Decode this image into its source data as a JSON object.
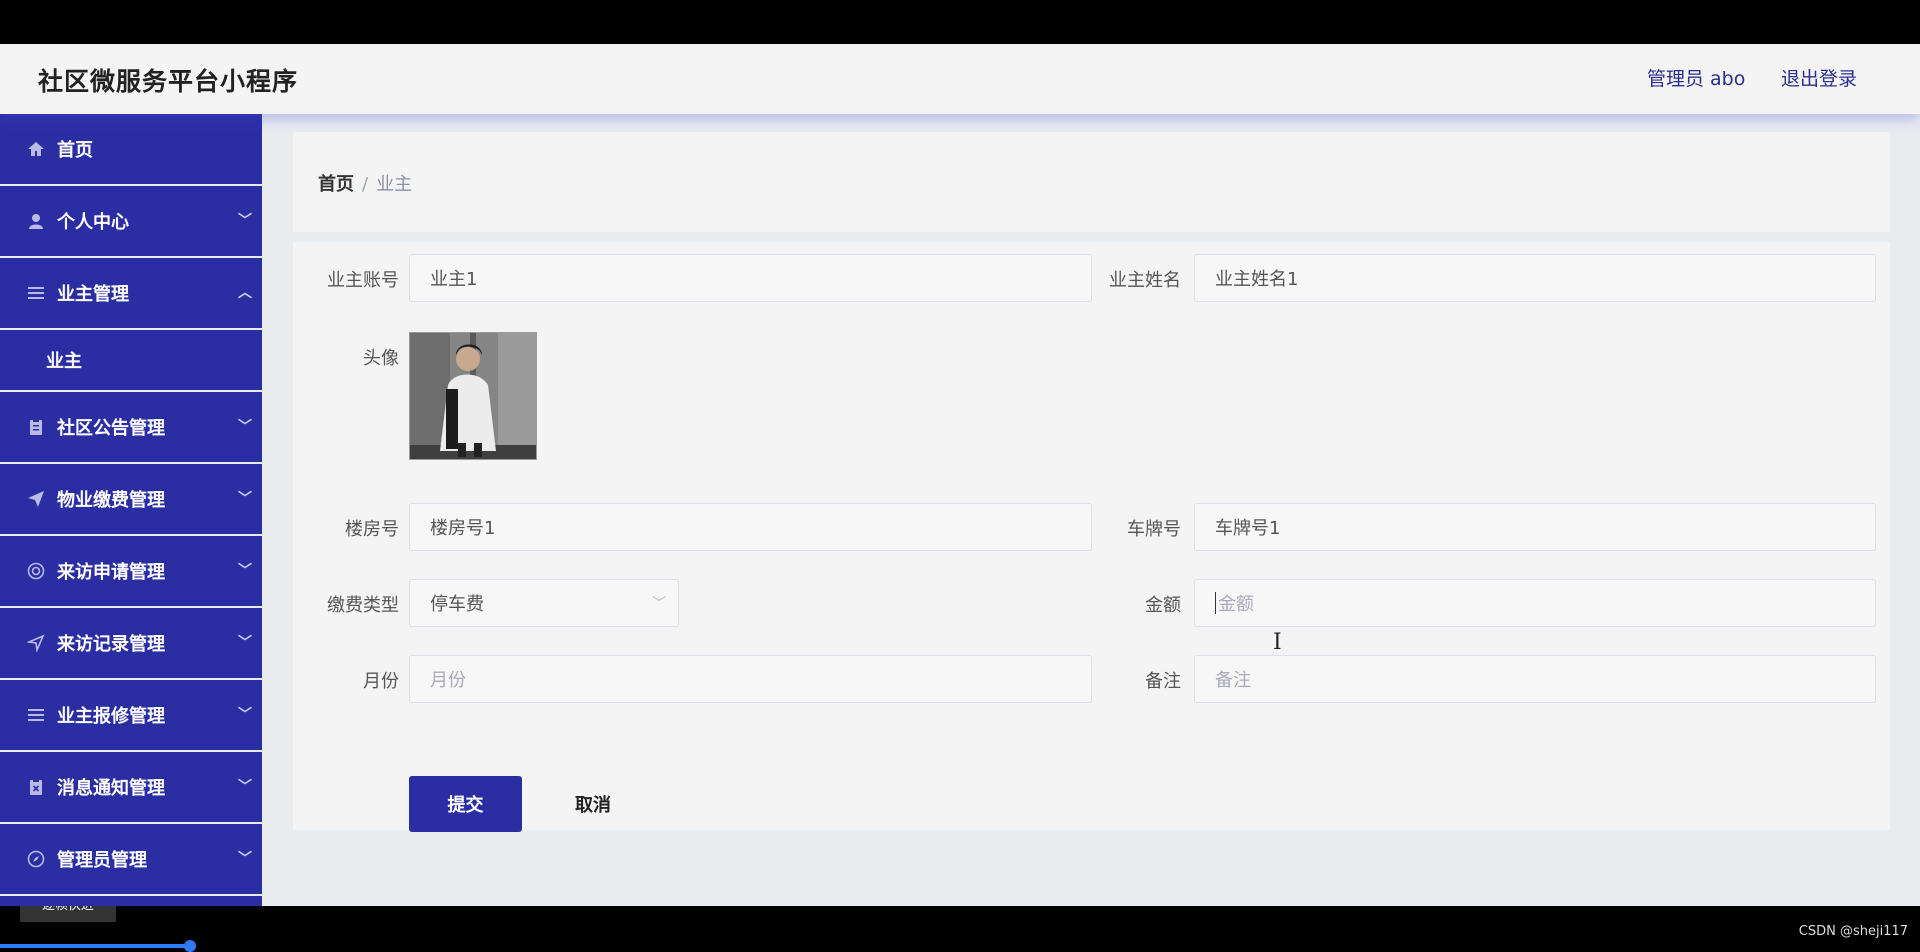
{
  "header": {
    "title": "社区微服务平台小程序",
    "user": "管理员 abo",
    "logout": "退出登录"
  },
  "sidebar": {
    "items": [
      {
        "label": "首页",
        "icon": "home-icon"
      },
      {
        "label": "个人中心",
        "icon": "user-icon"
      },
      {
        "label": "业主管理",
        "icon": "list-icon",
        "expanded": true
      },
      {
        "label": "业主",
        "sub": true
      },
      {
        "label": "社区公告管理",
        "icon": "clipboard-icon"
      },
      {
        "label": "物业缴费管理",
        "icon": "send-icon"
      },
      {
        "label": "来访申请管理",
        "icon": "lifebuoy-icon"
      },
      {
        "label": "来访记录管理",
        "icon": "navigation-icon"
      },
      {
        "label": "业主报修管理",
        "icon": "list-icon"
      },
      {
        "label": "消息通知管理",
        "icon": "clipboard-x-icon"
      },
      {
        "label": "管理员管理",
        "icon": "compass-icon"
      }
    ]
  },
  "breadcrumb": {
    "home": "首页",
    "separator": "/",
    "current": "业主"
  },
  "form": {
    "account_label": "业主账号",
    "account_value": "业主1",
    "name_label": "业主姓名",
    "name_value": "业主姓名1",
    "avatar_label": "头像",
    "building_label": "楼房号",
    "building_value": "楼房号1",
    "plate_label": "车牌号",
    "plate_value": "车牌号1",
    "fee_type_label": "缴费类型",
    "fee_type_value": "停车费",
    "amount_label": "金额",
    "amount_placeholder": "金额",
    "month_label": "月份",
    "month_placeholder": "月份",
    "remark_label": "备注",
    "remark_placeholder": "备注",
    "submit": "提交",
    "cancel": "取消"
  },
  "player": {
    "tip": "逐帧快进",
    "watermark": "CSDN @sheji117"
  },
  "colors": {
    "sidebar": "#2b2ea3",
    "accent": "#2b2ea3",
    "header_text": "#2a2f8f"
  }
}
